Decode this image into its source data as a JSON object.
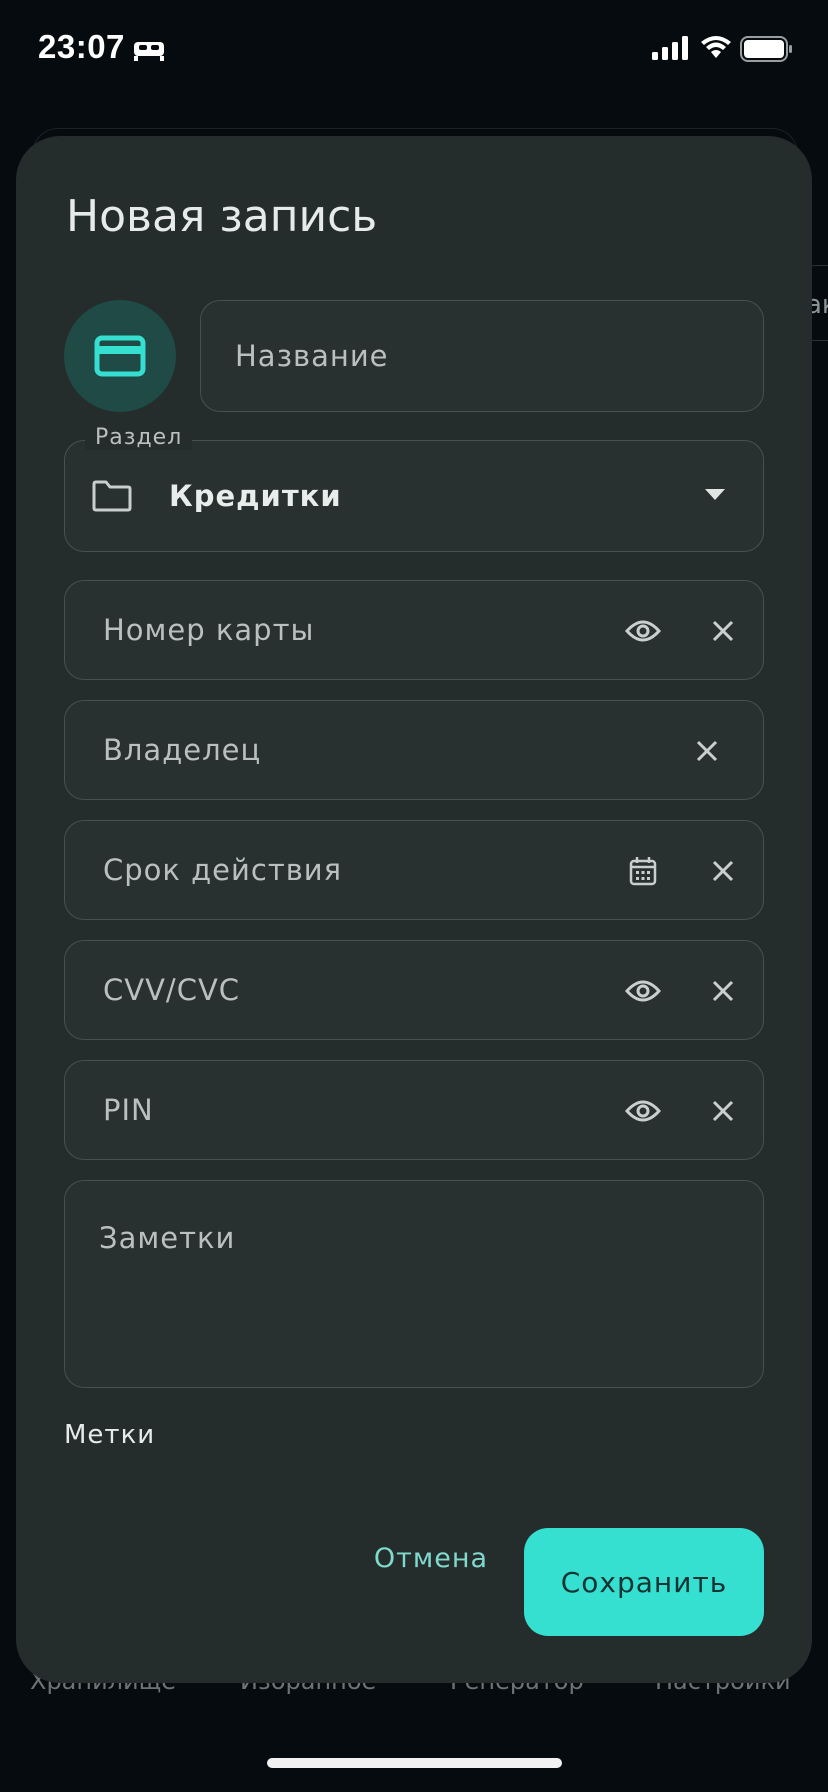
{
  "status_bar": {
    "time": "23:07"
  },
  "background": {
    "nav": [
      "Хранилище",
      "Избранное",
      "Генератор",
      "Настройки"
    ],
    "chip_text": "ак"
  },
  "dialog": {
    "title": "Новая запись",
    "name_placeholder": "Название",
    "section": {
      "legend": "Раздел",
      "value": "Кредитки"
    },
    "fields": {
      "card_number": "Номер карты",
      "owner": "Владелец",
      "expiry": "Срок действия",
      "cvv": "CVV/CVC",
      "pin": "PIN"
    },
    "notes_placeholder": "Заметки",
    "tags_label": "Метки",
    "cancel_label": "Отмена",
    "save_label": "Сохранить"
  },
  "colors": {
    "accent": "#35e0d0",
    "surface": "#252c2c",
    "avatar_bg": "#1f4a46"
  }
}
